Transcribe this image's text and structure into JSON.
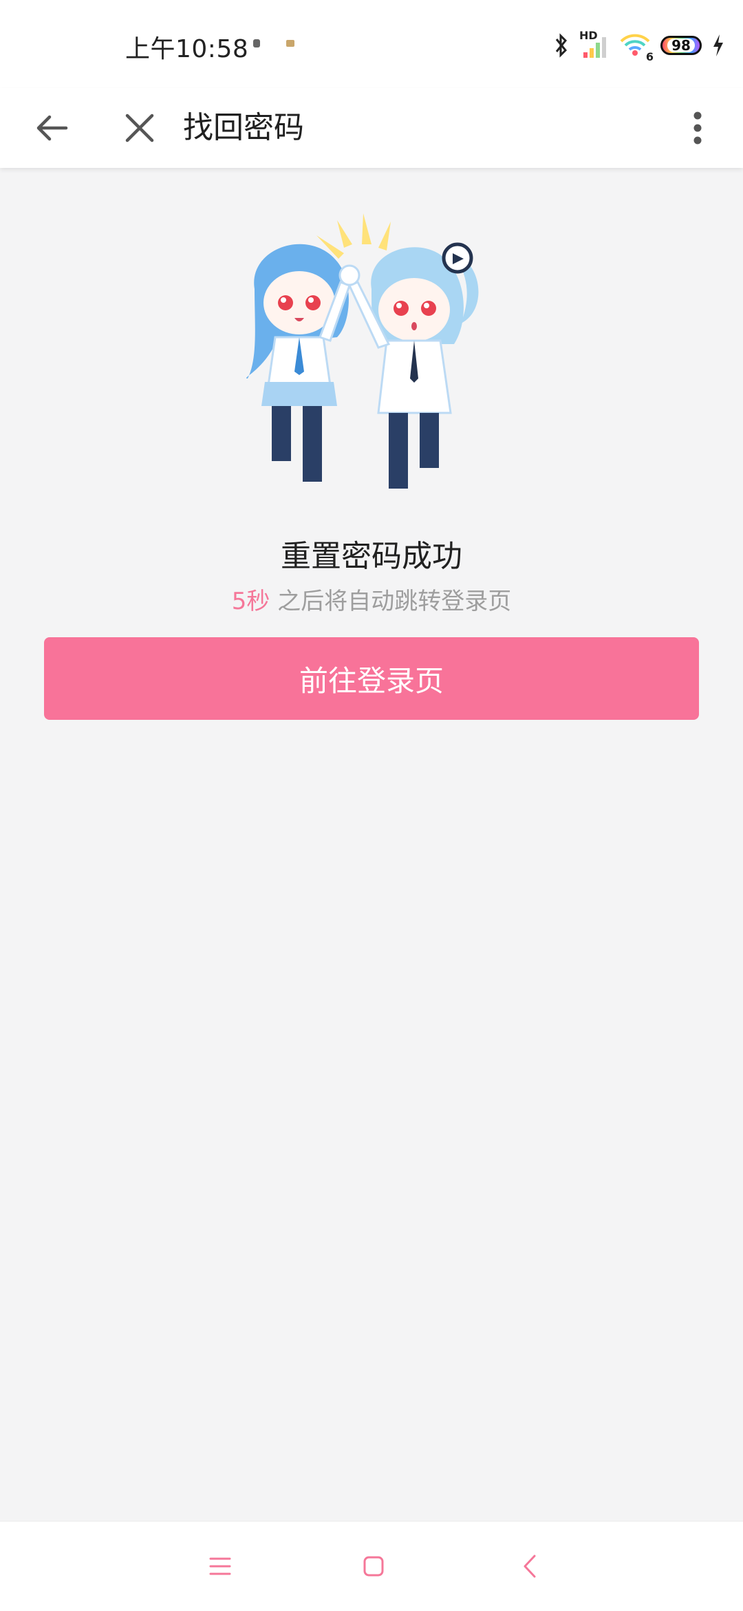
{
  "status_bar": {
    "time": "上午10:58",
    "battery": "98",
    "network": "HD",
    "wifi_badge": "6"
  },
  "app_bar": {
    "title": "找回密码",
    "icons": [
      "back-arrow-icon",
      "close-icon",
      "more-vertical-icon"
    ]
  },
  "content": {
    "title": "重置密码成功",
    "countdown_number": "5秒",
    "countdown_text": " 之后将自动跳转登录页",
    "button_label": "前往登录页"
  },
  "colors": {
    "accent": "#f87399",
    "countdown_accent": "#f57799",
    "background": "#f4f4f5",
    "nav_icons": "#f57799"
  },
  "nav_bar": {
    "icons": [
      "menu-icon",
      "home-square-icon",
      "back-chevron-icon"
    ]
  }
}
